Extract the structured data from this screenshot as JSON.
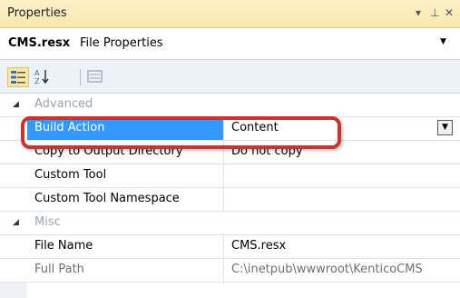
{
  "panel": {
    "title": "Properties",
    "pin_glyph": "▾ ╨ ✕"
  },
  "object_selector": {
    "name": "CMS.resx",
    "type": "File Properties",
    "dropdown_glyph": "▼"
  },
  "toolbar": {
    "categorized_icon": "categorized-icon",
    "alphabetical_icon": "alphabetical-icon",
    "property_pages_icon": "property-pages-icon"
  },
  "categories": [
    {
      "name": "Advanced",
      "properties": [
        {
          "name": "Build Action",
          "value": "Content"
        },
        {
          "name": "Copy to Output Directory",
          "value": "Do not copy"
        },
        {
          "name": "Custom Tool",
          "value": ""
        },
        {
          "name": "Custom Tool Namespace",
          "value": ""
        }
      ]
    },
    {
      "name": "Misc",
      "properties": [
        {
          "name": "File Name",
          "value": "CMS.resx"
        },
        {
          "name": "Full Path",
          "value": "C:\\inetpub\\wwwroot\\KenticoCMS"
        }
      ]
    }
  ],
  "colors": {
    "selection": "#3399ff",
    "callout": "#c8342f",
    "title_bar": "#fbe9b0"
  }
}
